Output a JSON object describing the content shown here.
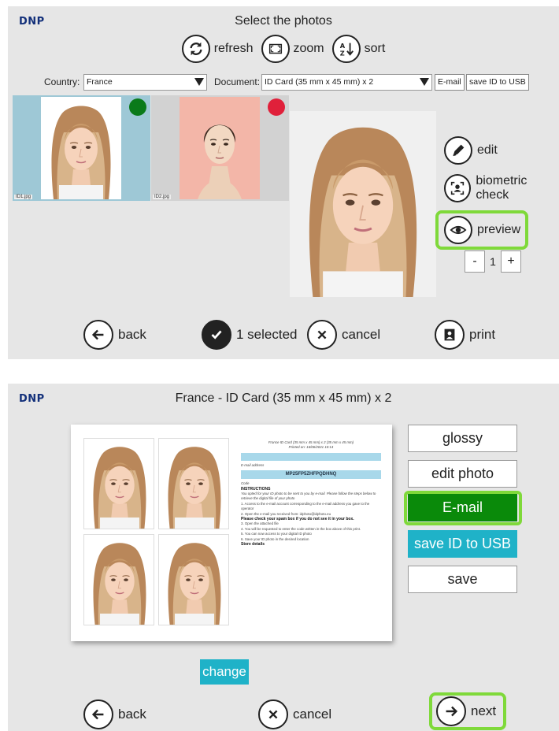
{
  "screen1": {
    "logo": "DNP",
    "title": "Select the photos",
    "toolbar": {
      "refresh": "refresh",
      "zoom": "zoom",
      "sort": "sort"
    },
    "country_label": "Country:",
    "country_value": "France",
    "document_label": "Document:",
    "document_value": "ID Card (35 mm x 45 mm) x 2",
    "email_btn": "E-mail",
    "save_usb_btn": "save ID to USB",
    "thumbs": [
      {
        "file": "ID1.jpg",
        "status_color": "#0a7a1a"
      },
      {
        "file": "ID2.jpg",
        "status_color": "#e0203a"
      }
    ],
    "side": {
      "edit": "edit",
      "biometric": "biometric check",
      "preview": "preview"
    },
    "stepper": {
      "minus": "-",
      "value": "1",
      "plus": "+"
    },
    "bottom": {
      "back": "back",
      "selected": "1 selected",
      "cancel": "cancel",
      "print": "print"
    }
  },
  "screen2": {
    "logo": "DNP",
    "title": "France - ID Card (35 mm x 45 mm) x 2",
    "sheet": {
      "header_line1": "France ID Card (35 mm x 45 mm) x 2 (35 mm x 45 mm)",
      "header_line2": "Printed on: 16/06/2021 10:14",
      "email_label": "E-mail address",
      "code": "MP25FP5ZHFPQDHNQ",
      "code_label": "Code",
      "instructions_title": "INSTRUCTIONS",
      "instructions_intro": "You opted for your ID photo to be sent to you by e-mail. Please follow the steps below to retrieve the digital file of your photo",
      "step1": "1. Access to the e-mail account corresponding to the e-mail address you gave to the operator",
      "step2": "2. Open the e-mail you received from: idphoto@idphoto.eu",
      "spam_note": "Please check your spam box if you do not see it in your box.",
      "step3": "3. Open the attached file",
      "step4": "4. You will be requested to enter the code written in the box above of this print.",
      "step5": "5. You can now access to your digital ID photo",
      "step6": "6. Save your ID photo in the desired location",
      "store": "Store details"
    },
    "right_buttons": {
      "glossy": "glossy",
      "edit_photo": "edit photo",
      "email": "E-mail",
      "save_usb": "save ID to USB",
      "save": "save"
    },
    "change": "change",
    "bottom": {
      "back": "back",
      "cancel": "cancel",
      "next": "next"
    }
  },
  "colors": {
    "highlight": "#7fd93a",
    "email_green": "#0a8a0a",
    "teal": "#1fb2c8",
    "logo_blue": "#13307a"
  }
}
